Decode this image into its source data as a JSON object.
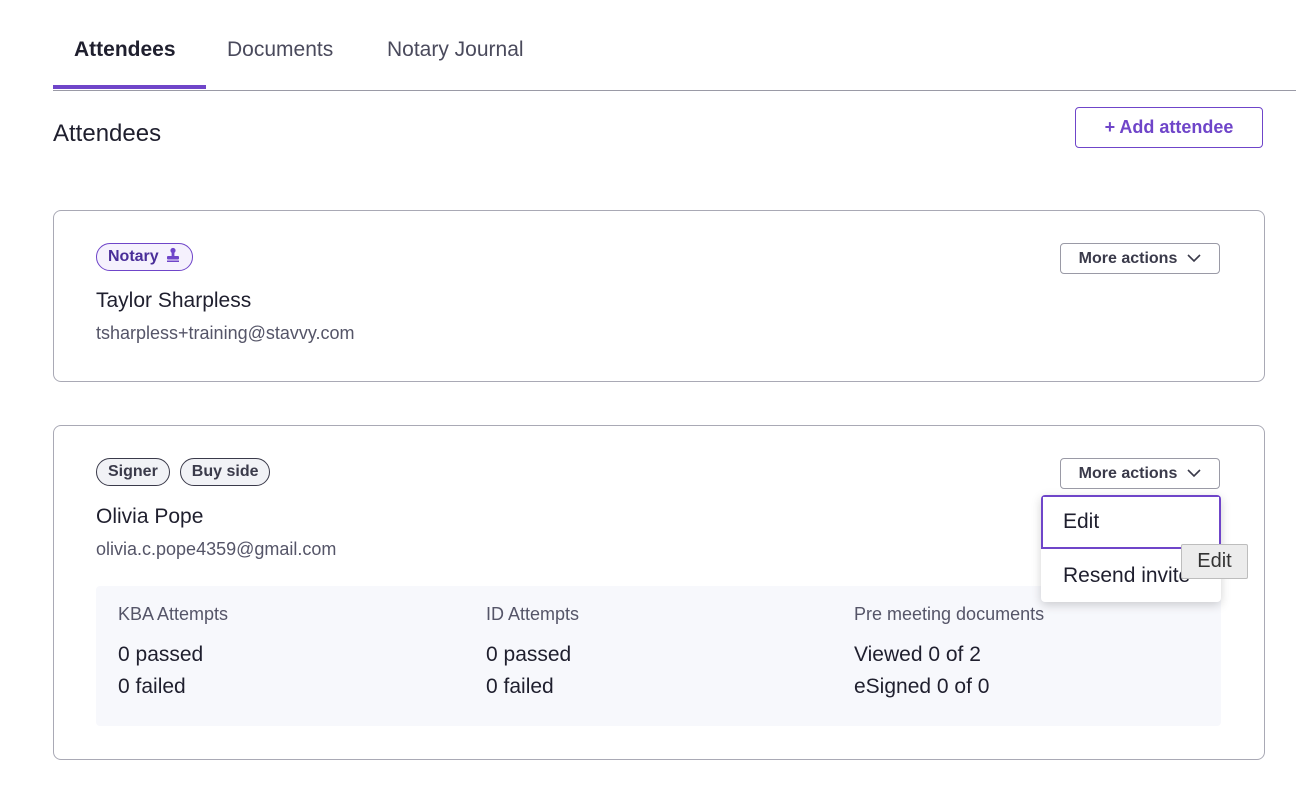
{
  "tabs": [
    {
      "label": "Attendees",
      "active": true
    },
    {
      "label": "Documents",
      "active": false
    },
    {
      "label": "Notary Journal",
      "active": false
    }
  ],
  "section": {
    "title": "Attendees",
    "add_button_label": "+ Add attendee"
  },
  "attendees": [
    {
      "badges": [
        "Notary"
      ],
      "name": "Taylor Sharpless",
      "email": "tsharpless+training@stavvy.com",
      "more_actions_label": "More actions"
    },
    {
      "badges": [
        "Signer",
        "Buy side"
      ],
      "name": "Olivia Pope",
      "email": "olivia.c.pope4359@gmail.com",
      "more_actions_label": "More actions",
      "stats": {
        "kba": {
          "label": "KBA Attempts",
          "passed": "0 passed",
          "failed": "0 failed"
        },
        "id": {
          "label": "ID Attempts",
          "passed": "0 passed",
          "failed": "0 failed"
        },
        "docs": {
          "label": "Pre meeting documents",
          "viewed": "Viewed 0 of 2",
          "esigned": "eSigned 0 of 0"
        }
      }
    }
  ],
  "dropdown": {
    "items": [
      "Edit",
      "Resend invite"
    ]
  },
  "tooltip": "Edit",
  "colors": {
    "accent": "#6f45c9",
    "border": "#a9a9b5",
    "stats_bg": "#f7f8fc"
  },
  "icons": {
    "notary_badge": "stamp-icon",
    "more_actions": "chevron-down-icon"
  }
}
